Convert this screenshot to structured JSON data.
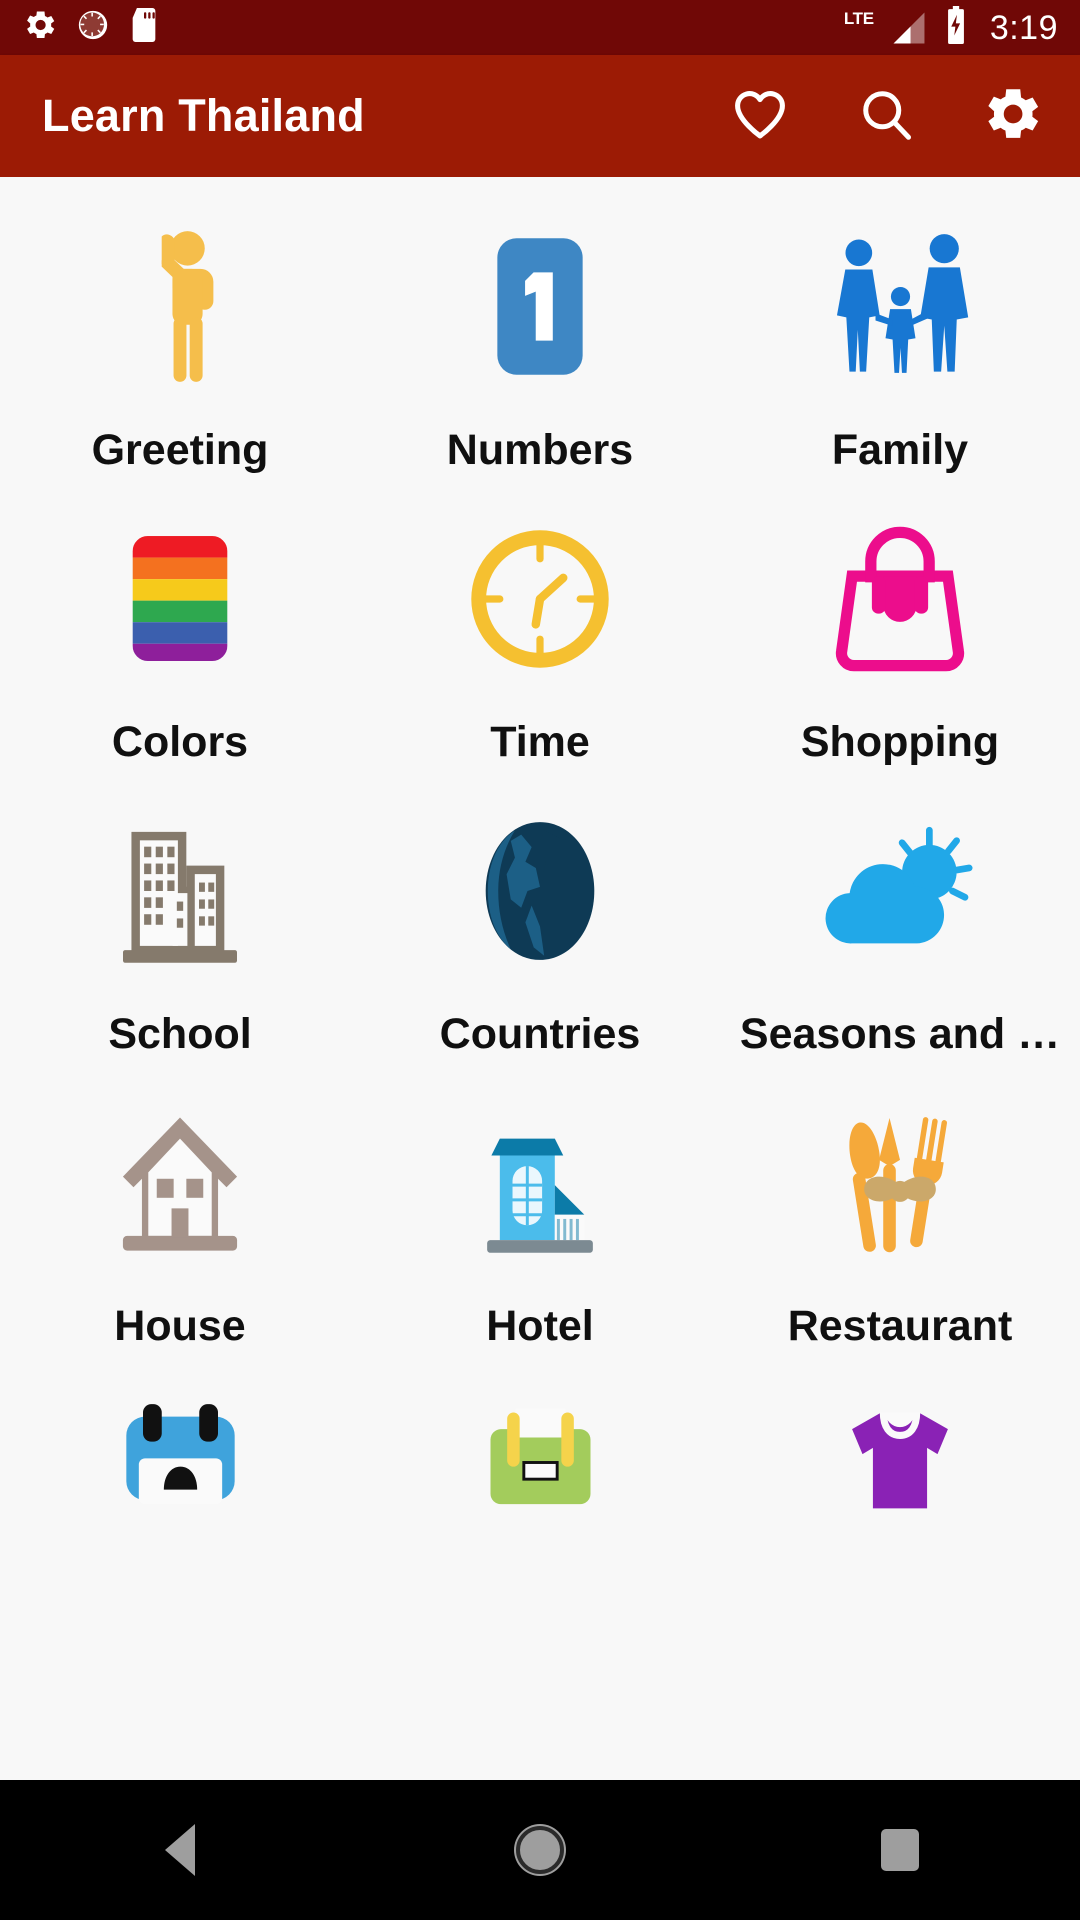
{
  "status_bar": {
    "background": "#700806",
    "left_icons": [
      {
        "name": "gear-icon",
        "label": "settings"
      },
      {
        "name": "alarm-icon",
        "label": "alarm"
      },
      {
        "name": "sd-card-icon",
        "label": "sd card"
      }
    ],
    "network_label": "LTE",
    "signal_icon": "signal-bars-icon",
    "battery_icon": "battery-charging-icon",
    "time": "3:19"
  },
  "app_bar": {
    "background": "#9C1B05",
    "title": "Learn Thailand",
    "actions": [
      {
        "name": "favorites-icon",
        "label": "Favorites"
      },
      {
        "name": "search-icon",
        "label": "Search"
      },
      {
        "name": "settings-gear-icon",
        "label": "Settings"
      }
    ]
  },
  "content": {
    "background": "#F8F8F8",
    "categories": [
      {
        "label": "Greeting",
        "icon": "waving-person-icon",
        "color": "#F5BE4B"
      },
      {
        "label": "Numbers",
        "icon": "number-one-icon",
        "color": "#3E87C4"
      },
      {
        "label": "Family",
        "icon": "family-icon",
        "color": "#1877D2"
      },
      {
        "label": "Colors",
        "icon": "rainbow-swatch-icon",
        "color": "#E81C1C"
      },
      {
        "label": "Time",
        "icon": "clock-icon",
        "color": "#F5C030"
      },
      {
        "label": "Shopping",
        "icon": "handbag-icon",
        "color": "#EC0D8C"
      },
      {
        "label": "School",
        "icon": "buildings-icon",
        "color": "#857A6C"
      },
      {
        "label": "Countries",
        "icon": "globe-icon",
        "color": "#134A68"
      },
      {
        "label": "Seasons and …",
        "icon": "sun-cloud-icon",
        "color": "#21A8E8"
      },
      {
        "label": "House",
        "icon": "house-icon",
        "color": "#A5938A"
      },
      {
        "label": "Hotel",
        "icon": "hotel-icon",
        "color": "#4BBCEB"
      },
      {
        "label": "Restaurant",
        "icon": "cutlery-icon",
        "color": "#F5A93A"
      }
    ],
    "partial_row": [
      {
        "icon": "car-icon",
        "color": "#3FA3DC"
      },
      {
        "icon": "briefcase-icon",
        "color": "#A3CC5C"
      },
      {
        "icon": "shirt-icon",
        "color": "#8A22B5"
      }
    ]
  },
  "nav_bar": {
    "background": "#000000",
    "buttons": [
      {
        "name": "nav-back-button",
        "label": "Back"
      },
      {
        "name": "nav-home-button",
        "label": "Home"
      },
      {
        "name": "nav-recents-button",
        "label": "Recents"
      }
    ]
  }
}
